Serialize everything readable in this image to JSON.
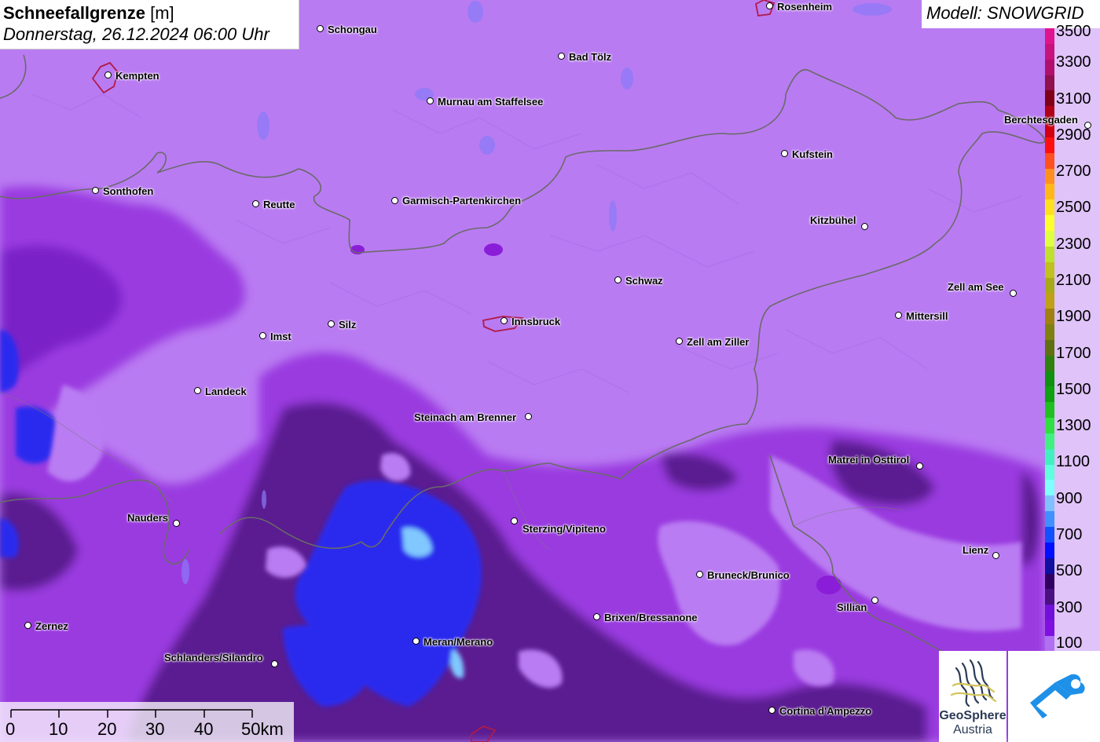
{
  "title": {
    "name": "Schneefallgrenze",
    "unit": "[m]",
    "datetime": "Donnerstag, 26.12.2024 06:00 Uhr"
  },
  "model": "Modell: SNOWGRID",
  "legend": {
    "labels": [
      "3500",
      "3300",
      "3100",
      "2900",
      "2700",
      "2500",
      "2300",
      "2100",
      "1900",
      "1700",
      "1500",
      "1300",
      "1100",
      "900",
      "700",
      "500",
      "300",
      "100"
    ],
    "colors": [
      "#e0148c",
      "#c8127c",
      "#b0106c",
      "#901050",
      "#800018",
      "#b00018",
      "#d00010",
      "#ff1010",
      "#ff5020",
      "#ff9020",
      "#ffb818",
      "#ffe020",
      "#ffff30",
      "#e0ff40",
      "#c0e030",
      "#c0c020",
      "#a8a818",
      "#c0a018",
      "#a08010",
      "#808010",
      "#607010",
      "#308010",
      "#109010",
      "#10a010",
      "#20c020",
      "#30e040",
      "#40f080",
      "#40f0c0",
      "#60ffe0",
      "#80ffff",
      "#80c0ff",
      "#4090ff",
      "#1050ff",
      "#0010ff",
      "#1010a0",
      "#300060",
      "#4a1080",
      "#7010d8",
      "#8010e0",
      "#b070f0"
    ]
  },
  "cities": [
    {
      "name": "Rosenheim"
    },
    {
      "name": "Schongau"
    },
    {
      "name": "Bad Tölz"
    },
    {
      "name": "Kempten"
    },
    {
      "name": "Murnau am Staffelsee"
    },
    {
      "name": "Berchtesgaden"
    },
    {
      "name": "Kufstein"
    },
    {
      "name": "Sonthofen"
    },
    {
      "name": "Reutte"
    },
    {
      "name": "Garmisch-Partenkirchen"
    },
    {
      "name": "Kitzbühel"
    },
    {
      "name": "Schwaz"
    },
    {
      "name": "Zell am See"
    },
    {
      "name": "Mittersill"
    },
    {
      "name": "Silz"
    },
    {
      "name": "Innsbruck"
    },
    {
      "name": "Imst"
    },
    {
      "name": "Zell am Ziller"
    },
    {
      "name": "Landeck"
    },
    {
      "name": "Steinach am Brenner"
    },
    {
      "name": "Matrei in Osttirol"
    },
    {
      "name": "Nauders"
    },
    {
      "name": "Sterzing/Vipiteno"
    },
    {
      "name": "Lienz"
    },
    {
      "name": "Bruneck/Brunico"
    },
    {
      "name": "Sillian"
    },
    {
      "name": "Brixen/Bressanone"
    },
    {
      "name": "Zernez"
    },
    {
      "name": "Meran/Merano"
    },
    {
      "name": "Schlanders/Silandro"
    },
    {
      "name": "Cortina d'Ampezzo"
    }
  ],
  "scale": {
    "labels": [
      "0",
      "10",
      "20",
      "30",
      "40",
      "50km"
    ]
  },
  "logo": {
    "line1": "GeoSphere",
    "line2": "Austria"
  }
}
